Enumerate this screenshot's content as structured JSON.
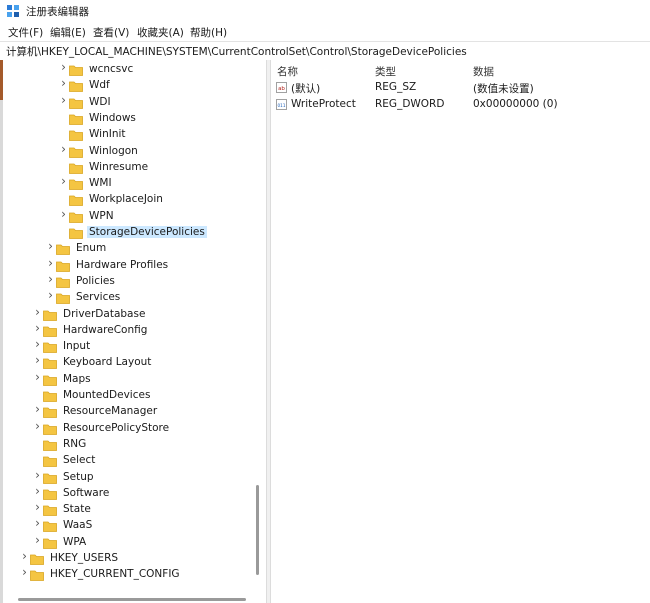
{
  "window": {
    "title": "注册表编辑器"
  },
  "menu": [
    "文件(F)",
    "编辑(E)",
    "查看(V)",
    "收藏夹(A)",
    "帮助(H)"
  ],
  "address": "计算机\\HKEY_LOCAL_MACHINE\\SYSTEM\\CurrentControlSet\\Control\\StorageDevicePolicies",
  "tree": [
    {
      "label": "wcncsvc",
      "level": 3,
      "expander": true
    },
    {
      "label": "Wdf",
      "level": 3,
      "expander": true
    },
    {
      "label": "WDI",
      "level": 3,
      "expander": true
    },
    {
      "label": "Windows",
      "level": 3,
      "expander": false
    },
    {
      "label": "WinInit",
      "level": 3,
      "expander": false
    },
    {
      "label": "Winlogon",
      "level": 3,
      "expander": true
    },
    {
      "label": "Winresume",
      "level": 3,
      "expander": false
    },
    {
      "label": "WMI",
      "level": 3,
      "expander": true
    },
    {
      "label": "WorkplaceJoin",
      "level": 3,
      "expander": false
    },
    {
      "label": "WPN",
      "level": 3,
      "expander": true
    },
    {
      "label": "StorageDevicePolicies",
      "level": 3,
      "expander": false,
      "selected": true
    },
    {
      "label": "Enum",
      "level": 2,
      "expander": true
    },
    {
      "label": "Hardware Profiles",
      "level": 2,
      "expander": true
    },
    {
      "label": "Policies",
      "level": 2,
      "expander": true
    },
    {
      "label": "Services",
      "level": 2,
      "expander": true
    },
    {
      "label": "DriverDatabase",
      "level": 1,
      "expander": true
    },
    {
      "label": "HardwareConfig",
      "level": 1,
      "expander": true
    },
    {
      "label": "Input",
      "level": 1,
      "expander": true
    },
    {
      "label": "Keyboard Layout",
      "level": 1,
      "expander": true
    },
    {
      "label": "Maps",
      "level": 1,
      "expander": true
    },
    {
      "label": "MountedDevices",
      "level": 1,
      "expander": false
    },
    {
      "label": "ResourceManager",
      "level": 1,
      "expander": true
    },
    {
      "label": "ResourcePolicyStore",
      "level": 1,
      "expander": true
    },
    {
      "label": "RNG",
      "level": 1,
      "expander": false
    },
    {
      "label": "Select",
      "level": 1,
      "expander": false
    },
    {
      "label": "Setup",
      "level": 1,
      "expander": true
    },
    {
      "label": "Software",
      "level": 1,
      "expander": true
    },
    {
      "label": "State",
      "level": 1,
      "expander": true
    },
    {
      "label": "WaaS",
      "level": 1,
      "expander": true
    },
    {
      "label": "WPA",
      "level": 1,
      "expander": true
    },
    {
      "label": "HKEY_USERS",
      "level": 0,
      "expander": true
    },
    {
      "label": "HKEY_CURRENT_CONFIG",
      "level": 0,
      "expander": true
    }
  ],
  "columns": {
    "name": "名称",
    "type": "类型",
    "data": "数据"
  },
  "values": [
    {
      "icon": "string-value-icon",
      "icon_text": "ab",
      "name": "(默认)",
      "type": "REG_SZ",
      "data": "(数值未设置)"
    },
    {
      "icon": "binary-value-icon",
      "icon_text": "011",
      "name": "WriteProtect",
      "type": "REG_DWORD",
      "data": "0x00000000 (0)"
    }
  ],
  "colors": {
    "folder": "#f4c542",
    "selection": "#cce8ff",
    "accent": "#a45a2a"
  }
}
